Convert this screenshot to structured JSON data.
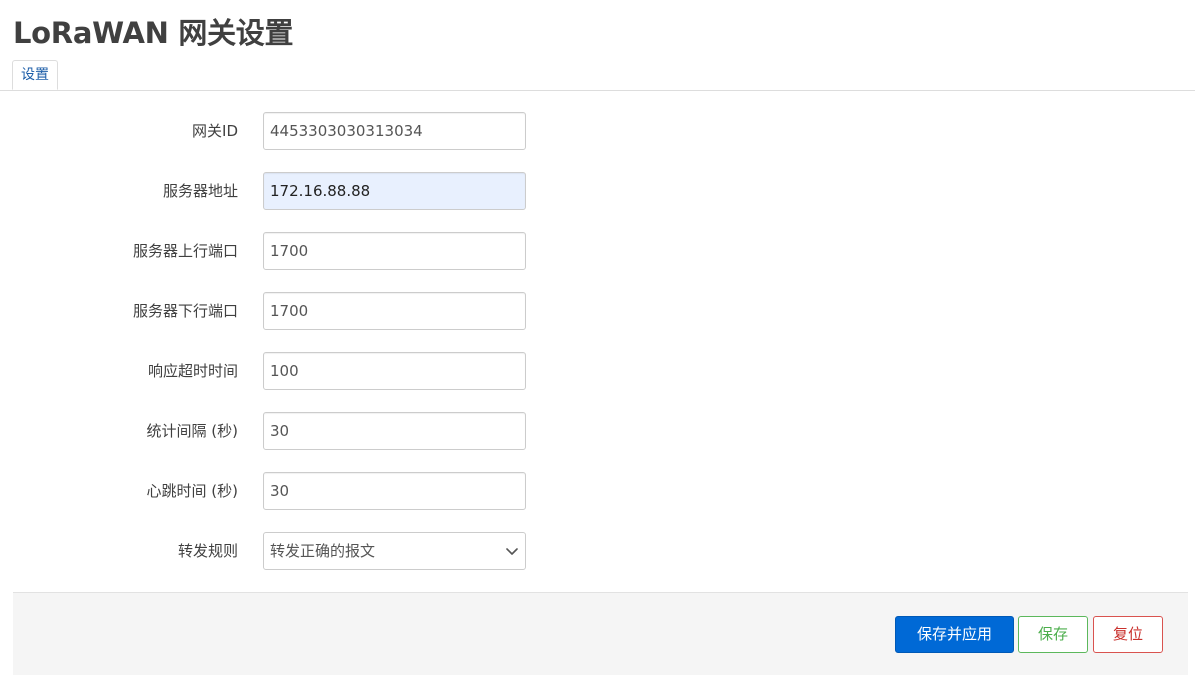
{
  "page": {
    "title": "LoRaWAN 网关设置"
  },
  "tabs": [
    {
      "label": "设置"
    }
  ],
  "form": {
    "gateway_id": {
      "label": "网关ID",
      "value": "4453303030313034"
    },
    "server_address": {
      "label": "服务器地址",
      "value": "172.16.88.88"
    },
    "server_up_port": {
      "label": "服务器上行端口",
      "value": "1700"
    },
    "server_down_port": {
      "label": "服务器下行端口",
      "value": "1700"
    },
    "response_timeout": {
      "label": "响应超时时间",
      "value": "100"
    },
    "stat_interval": {
      "label": "统计间隔 (秒)",
      "value": "30"
    },
    "heartbeat_time": {
      "label": "心跳时间 (秒)",
      "value": "30"
    },
    "forward_rule": {
      "label": "转发规则",
      "selected": "转发正确的报文"
    }
  },
  "buttons": {
    "save_apply": "保存并应用",
    "save": "保存",
    "reset": "复位"
  },
  "colors": {
    "primary": "#0069d6",
    "save": "#5cb85c",
    "reset": "#d9534f",
    "tab_text": "#1d5ea8",
    "autofill_bg": "#e8f0fe"
  }
}
